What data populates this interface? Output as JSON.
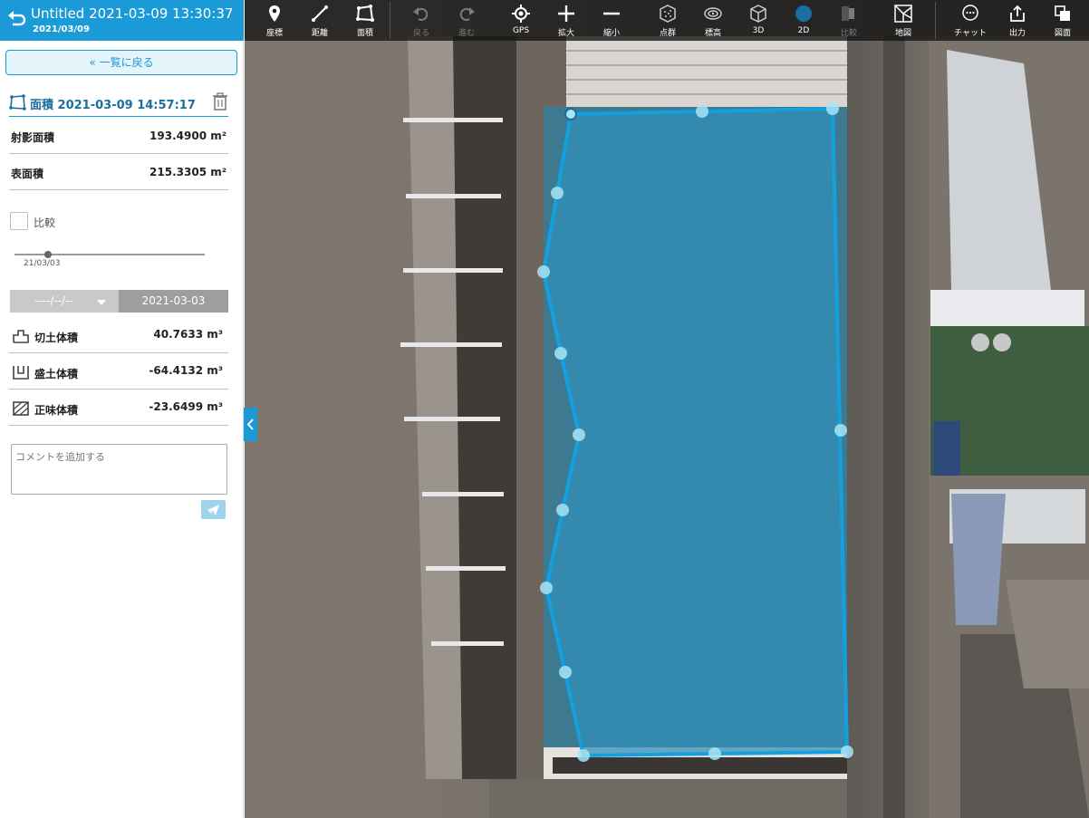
{
  "header": {
    "title": "Untitled 2021-03-09 13:30:37",
    "subtitle": "2021/03/09"
  },
  "sidebar": {
    "back_label": "« 一覧に戻る",
    "measurement_title": "面積 2021-03-09 14:57:17",
    "projected_area": {
      "label": "射影面積",
      "value": "193.4900 m²"
    },
    "surface_area": {
      "label": "表面積",
      "value": "215.3305 m²"
    },
    "compare": {
      "label": "比較",
      "checked": false
    },
    "slider": {
      "label": "21/03/03"
    },
    "date_select": {
      "value": "----/--/--"
    },
    "date_fixed": "2021-03-03",
    "volumes": [
      {
        "label": "切土体積",
        "value": "40.7633 m³",
        "icon": "cut-volume-icon"
      },
      {
        "label": "盛土体積",
        "value": "-64.4132 m³",
        "icon": "fill-volume-icon"
      },
      {
        "label": "正味体積",
        "value": "-23.6499 m³",
        "icon": "net-volume-icon"
      }
    ],
    "comment_placeholder": "コメントを追加する"
  },
  "toolbar": {
    "items": [
      {
        "label": "座標",
        "icon": "location-pin-icon",
        "enabled": true
      },
      {
        "label": "距離",
        "icon": "distance-line-icon",
        "enabled": true
      },
      {
        "label": "面積",
        "icon": "area-polygon-icon",
        "enabled": true
      },
      {
        "label": "戻る",
        "icon": "undo-icon",
        "enabled": false
      },
      {
        "label": "進む",
        "icon": "redo-icon",
        "enabled": false
      },
      {
        "label": "GPS",
        "icon": "gps-target-icon",
        "enabled": true
      },
      {
        "label": "拡大",
        "icon": "zoom-in-icon",
        "enabled": true
      },
      {
        "label": "縮小",
        "icon": "zoom-out-icon",
        "enabled": true
      },
      {
        "label": "点群",
        "icon": "point-cloud-icon",
        "enabled": true
      },
      {
        "label": "標高",
        "icon": "elevation-icon",
        "enabled": true
      },
      {
        "label": "3D",
        "icon": "cube-3d-icon",
        "enabled": true
      },
      {
        "label": "2D",
        "icon": "circle-2d-icon",
        "enabled": true
      },
      {
        "label": "比較",
        "icon": "compare-icon",
        "enabled": false
      },
      {
        "label": "地図",
        "icon": "map-icon",
        "enabled": true
      },
      {
        "label": "チャット",
        "icon": "chat-icon",
        "enabled": true
      },
      {
        "label": "出力",
        "icon": "export-icon",
        "enabled": true
      },
      {
        "label": "図面",
        "icon": "drawing-icon",
        "enabled": true
      }
    ]
  },
  "colors": {
    "accent": "#1a9ad6",
    "polygon_fill": "#3a9ec4",
    "polygon_stroke": "#14a0df",
    "vertex": "#a8e4f6"
  }
}
